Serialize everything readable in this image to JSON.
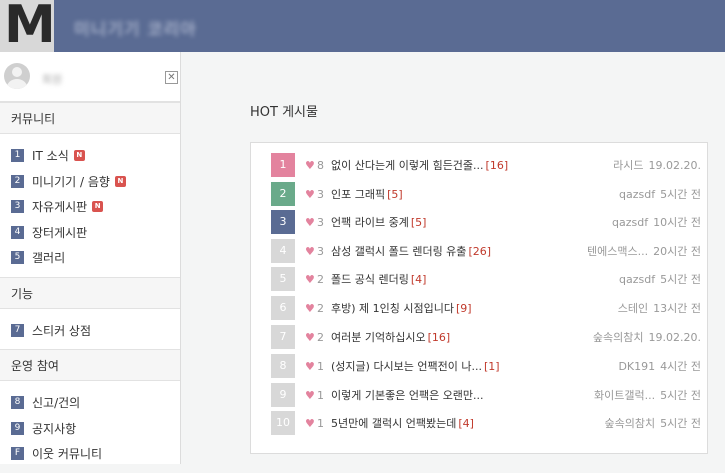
{
  "header": {
    "logo_letter": "M",
    "site_title": "미니기기 코리아"
  },
  "user": {
    "name": "회원",
    "close_label": "✕"
  },
  "sidebar": {
    "sections": [
      {
        "title": "커뮤니티",
        "items": [
          {
            "num": "1",
            "label": "IT 소식",
            "new": "N"
          },
          {
            "num": "2",
            "label": "미니기기 / 음향",
            "new": "N"
          },
          {
            "num": "3",
            "label": "자유게시판",
            "new": "N"
          },
          {
            "num": "4",
            "label": "장터게시판",
            "new": ""
          },
          {
            "num": "5",
            "label": "갤러리",
            "new": ""
          }
        ]
      },
      {
        "title": "기능",
        "items": [
          {
            "num": "7",
            "label": "스티커 상점",
            "new": ""
          }
        ]
      },
      {
        "title": "운영 참여",
        "items": [
          {
            "num": "8",
            "label": "신고/건의",
            "new": ""
          },
          {
            "num": "9",
            "label": "공지사항",
            "new": ""
          },
          {
            "num": "F",
            "label": "이웃 커뮤니티",
            "new": ""
          }
        ]
      }
    ]
  },
  "hot": {
    "title": "HOT 게시물",
    "rank_colors": {
      "1": "#e3839e",
      "2": "#6aaa8a",
      "3": "#5a6b93",
      "default": "#d8d8d8"
    },
    "posts": [
      {
        "rank": "1",
        "likes": "8",
        "title": "없이 산다는게 이렇게 힘든건줄...",
        "comments": "[16]",
        "author": "라시드",
        "time": "19.02.20."
      },
      {
        "rank": "2",
        "likes": "3",
        "title": "인포 그래픽",
        "comments": "[5]",
        "author": "qazsdf",
        "time": "5시간 전"
      },
      {
        "rank": "3",
        "likes": "3",
        "title": "언팩 라이브 중계",
        "comments": "[5]",
        "author": "qazsdf",
        "time": "10시간 전"
      },
      {
        "rank": "4",
        "likes": "3",
        "title": "삼성 갤럭시 폴드 렌더링 유출",
        "comments": "[26]",
        "author": "텐에스맥스...",
        "time": "20시간 전"
      },
      {
        "rank": "5",
        "likes": "2",
        "title": "폴드 공식 렌더링",
        "comments": "[4]",
        "author": "qazsdf",
        "time": "5시간 전"
      },
      {
        "rank": "6",
        "likes": "2",
        "title": "후방) 제 1인칭 시점입니다",
        "comments": "[9]",
        "author": "스테인",
        "time": "13시간 전"
      },
      {
        "rank": "7",
        "likes": "2",
        "title": "여러분 기억하십시오",
        "comments": "[16]",
        "author": "숲속의참치",
        "time": "19.02.20."
      },
      {
        "rank": "8",
        "likes": "1",
        "title": "(성지글) 다시보는 언팩전이 나...",
        "comments": "[1]",
        "author": "DK191",
        "time": "4시간 전"
      },
      {
        "rank": "9",
        "likes": "1",
        "title": "이렇게 기본좋은 언팩은 오랜만...",
        "comments": "",
        "author": "화이트갤럭...",
        "time": "5시간 전"
      },
      {
        "rank": "10",
        "likes": "1",
        "title": "5년만에 갤럭시 언팩봤는데",
        "comments": "[4]",
        "author": "숲속의참치",
        "time": "5시간 전"
      }
    ]
  }
}
